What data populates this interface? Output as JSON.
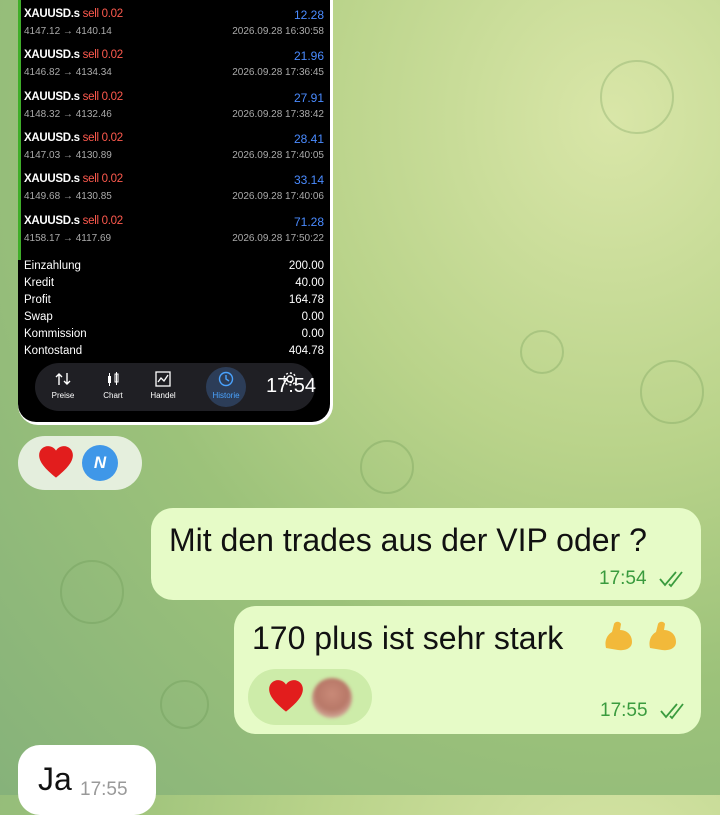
{
  "screenshot": {
    "trades": [
      {
        "symbol": "XAUUSD.s",
        "side": "sell 0.02",
        "profit": "12.28",
        "price": "4147.12 → 4140.14",
        "time": "2026.09.28 16:30:58"
      },
      {
        "symbol": "XAUUSD.s",
        "side": "sell 0.02",
        "profit": "21.96",
        "price": "4146.82 → 4134.34",
        "time": "2026.09.28 17:36:45"
      },
      {
        "symbol": "XAUUSD.s",
        "side": "sell 0.02",
        "profit": "27.91",
        "price": "4148.32 → 4132.46",
        "time": "2026.09.28 17:38:42"
      },
      {
        "symbol": "XAUUSD.s",
        "side": "sell 0.02",
        "profit": "28.41",
        "price": "4147.03 → 4130.89",
        "time": "2026.09.28 17:40:05"
      },
      {
        "symbol": "XAUUSD.s",
        "side": "sell 0.02",
        "profit": "33.14",
        "price": "4149.68 → 4130.85",
        "time": "2026.09.28 17:40:06"
      },
      {
        "symbol": "XAUUSD.s",
        "side": "sell 0.02",
        "profit": "71.28",
        "price": "4158.17 → 4117.69",
        "time": "2026.09.28 17:50:22"
      }
    ],
    "summary": [
      {
        "label": "Einzahlung",
        "value": "200.00"
      },
      {
        "label": "Kredit",
        "value": "40.00"
      },
      {
        "label": "Profit",
        "value": "164.78"
      },
      {
        "label": "Swap",
        "value": "0.00"
      },
      {
        "label": "Kommission",
        "value": "0.00"
      },
      {
        "label": "Kontostand",
        "value": "404.78"
      }
    ],
    "nav": [
      "Preise",
      "Chart",
      "Handel",
      "Historie",
      "Einstellungen"
    ],
    "active_nav": "Historie",
    "time": "17:54"
  },
  "reactions_1": {
    "avatar_letter": "N"
  },
  "messages": {
    "out1": {
      "text": "Mit den trades aus der VIP oder ?",
      "time": "17:54"
    },
    "out2": {
      "text": "170 plus ist sehr stark",
      "time": "17:55"
    },
    "inc1": {
      "text": "Ja",
      "time": "17:55"
    }
  },
  "colors": {
    "accent_blue": "#4a8bff",
    "sell_red": "#ff5a4e",
    "bubble_out": "#e6fbc7",
    "tick_green": "#3a9b3e"
  }
}
